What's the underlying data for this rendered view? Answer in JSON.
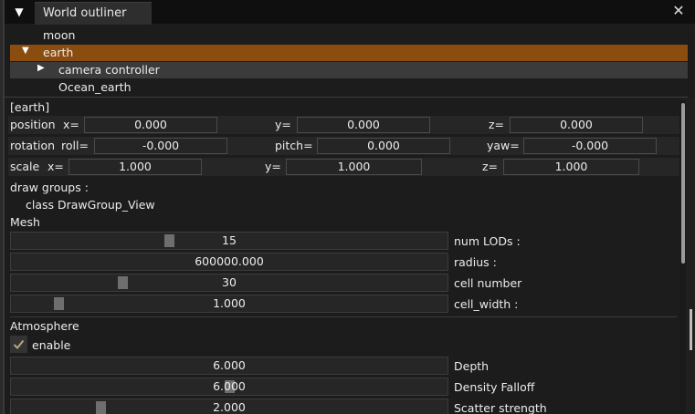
{
  "titlebar": {
    "collapse_icon": "▼",
    "tab_label": "World outliner",
    "close_icon": "✕"
  },
  "outliner": {
    "items": [
      {
        "label": "moon"
      },
      {
        "label": "earth",
        "arrow": "▼",
        "selected": true
      },
      {
        "label": "camera controller",
        "arrow": "▶"
      },
      {
        "label": "Ocean_earth"
      }
    ]
  },
  "props": {
    "entity_name": "[earth]",
    "position": {
      "label": "position",
      "x_label": "x=",
      "x": "0.000",
      "y_label": "y=",
      "y": "0.000",
      "z_label": "z=",
      "z": "0.000"
    },
    "rotation": {
      "label": "rotation",
      "x_label": "roll=",
      "x": "-0.000",
      "y_label": "pitch=",
      "y": "0.000",
      "z_label": "yaw=",
      "z": "-0.000"
    },
    "scale": {
      "label": "scale",
      "x_label": "x=",
      "x": "1.000",
      "y_label": "y=",
      "y": "1.000",
      "z_label": "z=",
      "z": "1.000"
    },
    "draw_groups_label": "draw groups :",
    "draw_group_item": "class DrawGroup_View",
    "mesh": {
      "title": "Mesh",
      "rows": [
        {
          "value": "15",
          "label": "num LODs :",
          "level": 0.36
        },
        {
          "value": "600000.000",
          "label": "radius :",
          "level": null
        },
        {
          "value": "30",
          "label": "cell number",
          "level": 0.25
        },
        {
          "value": "1.000",
          "label": "cell_width :",
          "level": 0.1
        }
      ]
    },
    "atmosphere": {
      "title": "Atmosphere",
      "enable_label": "enable",
      "enabled": true,
      "rows": [
        {
          "value": "6.000",
          "label": "Depth",
          "level": null
        },
        {
          "value": "6.000",
          "label": "Density Falloff",
          "level": 0.5
        },
        {
          "value": "2.000",
          "label": "Scatter strength",
          "level": 0.2
        }
      ]
    }
  }
}
